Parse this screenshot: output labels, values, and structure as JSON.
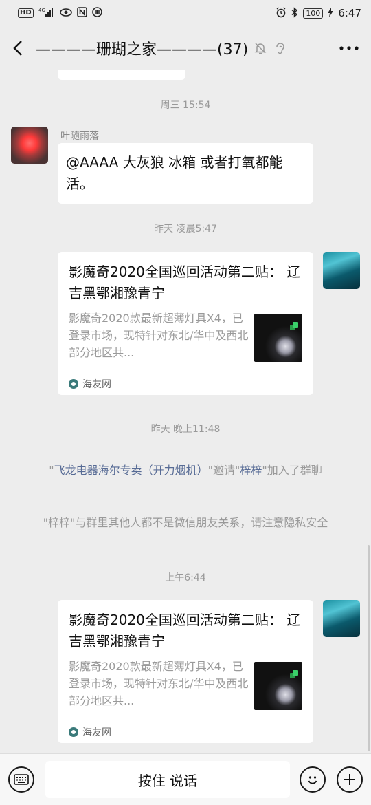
{
  "status_bar": {
    "left_icons": [
      "hd-icon",
      "4g-signal-icon",
      "eye-icon",
      "nfc-icon",
      "vpn-icon"
    ],
    "hd": "HD",
    "network": "4G",
    "battery": "100",
    "time": "6:47"
  },
  "header": {
    "title": "————珊瑚之家————(37)"
  },
  "messages": {
    "ts1": "周三 15:54",
    "m1_sender": "叶随雨落",
    "m1_text": "@AAAA 大灰狼  冰箱 或者打氧都能活。",
    "ts2": "昨天 凌晨5:47",
    "card1": {
      "title": "影魔奇2020全国巡回活动第二贴： 辽吉黑鄂湘豫青宁",
      "desc": "影魔奇2020款最新超薄灯具X4，已登录市场，现特针对东北/华中及西北部分地区共...",
      "source": "海友网"
    },
    "ts3": "昨天 晚上11:48",
    "sys1": {
      "q1": "\"",
      "inviter": "飞龙电器海尔专卖（开力烟机）",
      "mid": "\"邀请\"",
      "invitee": "梓梓",
      "tail": "\"加入了群聊"
    },
    "sys2": "\"梓梓\"与群里其他人都不是微信朋友关系，请注意隐私安全",
    "ts4": "上午6:44",
    "card2": {
      "title": "影魔奇2020全国巡回活动第二贴： 辽吉黑鄂湘豫青宁",
      "desc": "影魔奇2020款最新超薄灯具X4，已登录市场，现特针对东北/华中及西北部分地区共...",
      "source": "海友网"
    }
  },
  "input_bar": {
    "hold_to_talk": "按住 说话"
  },
  "colors": {
    "background": "#ededed",
    "link": "#576b95",
    "bubble": "#ffffff"
  }
}
